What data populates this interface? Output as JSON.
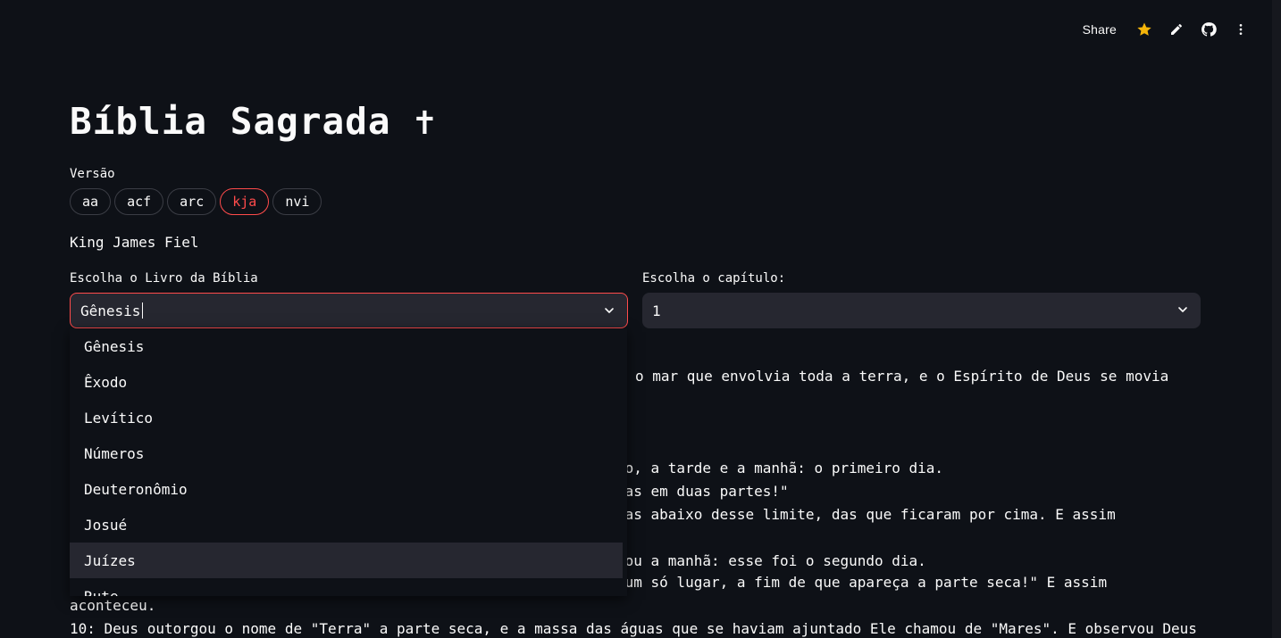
{
  "toolbar": {
    "share_label": "Share",
    "icons": [
      "star-icon",
      "pencil-icon",
      "github-icon",
      "more-vertical-icon"
    ],
    "star_color": "#f5b50a"
  },
  "title": "Bíblia Sagrada ✝",
  "version": {
    "label": "Versão",
    "options": [
      "aa",
      "acf",
      "arc",
      "kja",
      "nvi"
    ],
    "selected": "kja",
    "selected_name": "King James Fiel"
  },
  "book_select": {
    "label": "Escolha o Livro da Bíblia",
    "value": "Gênesis",
    "options": [
      "Gênesis",
      "Êxodo",
      "Levítico",
      "Números",
      "Deuteronômio",
      "Josué",
      "Juízes",
      "Rute"
    ],
    "highlighted": "Juízes"
  },
  "chapter_select": {
    "label": "Escolha o capítulo:",
    "value": "1"
  },
  "verses_visible": [
    "o mar que envolvia toda a terra, e o Espírito de Deus se movia",
    "ão, a tarde e a manhã: o primeiro dia.",
    "las em duas partes!\"",
    "das abaixo desse limite, das que ficaram por cima. E assim",
    "iou a manhã: esse foi o segundo dia.",
    "num só lugar, a fim de que apareça a parte seca!\" E assim",
    "aconteceu.",
    "10: Deus outorgou o nome de \"Terra\" a parte seca, e a massa das águas que se haviam ajuntado Ele chamou de \"Mares\". E observou Deus"
  ],
  "colors": {
    "background": "#0e1117",
    "accent": "#ff4b4b",
    "input_bg": "#262730"
  }
}
